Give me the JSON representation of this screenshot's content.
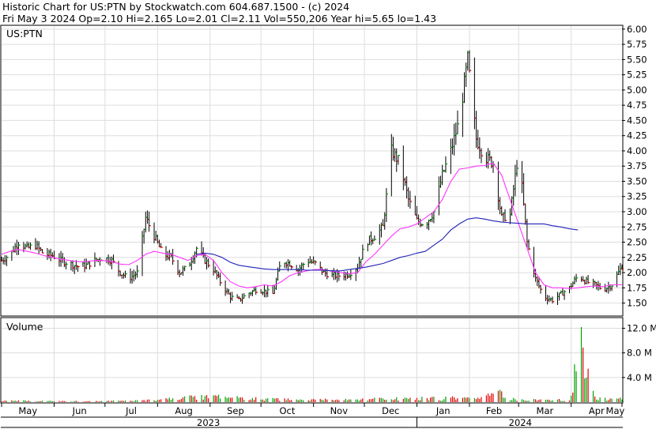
{
  "header": {
    "line1": "Historic Chart for US:PTN by Stockwatch.com 604.687.1500 - (c) 2024",
    "line2": "Fri May  3 2024  Op=2.10  Hi=2.165  Lo=2.01  Cl=2.11  Vol=550,206  Year hi=5.65  lo=1.43"
  },
  "colors": {
    "up": "#00a000",
    "down": "#e00000",
    "bar": "#000000",
    "ma_short": "#ff33ff",
    "ma_long": "#2222bb",
    "grid": "#dddddd",
    "volume_spike": "#00a000"
  },
  "chart_data": [
    {
      "type": "candlestick",
      "title": "US:PTN",
      "ylim": [
        1.3,
        6.05
      ],
      "y_ticks": [
        "6.00",
        "5.75",
        "5.50",
        "5.25",
        "5.00",
        "4.75",
        "4.50",
        "4.25",
        "4.00",
        "3.75",
        "3.50",
        "3.25",
        "3.00",
        "2.75",
        "2.50",
        "2.25",
        "2.00",
        "1.75",
        "1.50"
      ],
      "x_ticks": [
        "May",
        "Jun",
        "Jul",
        "Aug",
        "Sep",
        "Oct",
        "Nov",
        "Dec",
        "Jan",
        "Feb",
        "Mar",
        "Apr",
        "May"
      ],
      "x_years": [
        "2023",
        "2024"
      ],
      "grid": true,
      "price_x": [
        0,
        5,
        10,
        15,
        20,
        25,
        30,
        35,
        40,
        45,
        50,
        55,
        60,
        65,
        70,
        75,
        80,
        85,
        90,
        95,
        100,
        105,
        110,
        115,
        120,
        125,
        130,
        135,
        140,
        145,
        150,
        155,
        160,
        165,
        170,
        175,
        180,
        185,
        190,
        195,
        200,
        205,
        210,
        215,
        220,
        225,
        230,
        235,
        240,
        245,
        250,
        255,
        260,
        265,
        270,
        275,
        280,
        285,
        290,
        295,
        300,
        305,
        310,
        315,
        320,
        325,
        330,
        335,
        340,
        345,
        350,
        355,
        360,
        366
      ],
      "price_close": [
        2.2,
        2.3,
        2.5,
        2.4,
        2.45,
        2.3,
        2.28,
        2.2,
        2.15,
        2.1,
        2.12,
        2.2,
        2.25,
        2.2,
        2.0,
        1.9,
        2.0,
        2.9,
        2.6,
        2.3,
        2.25,
        2.0,
        2.1,
        2.4,
        2.2,
        2.05,
        1.8,
        1.6,
        1.55,
        1.65,
        1.72,
        1.7,
        1.65,
        2.2,
        2.15,
        2.05,
        2.2,
        2.15,
        2.0,
        1.95,
        1.95,
        1.98,
        2.1,
        2.5,
        2.6,
        2.75,
        4.0,
        3.8,
        3.2,
        2.85,
        2.8,
        3.0,
        3.6,
        4.0,
        4.5,
        5.5,
        4.2,
        3.9,
        3.8,
        2.9,
        2.95,
        4.0,
        2.5,
        1.9,
        1.6,
        1.55,
        1.65,
        1.75,
        1.95,
        1.85,
        1.8,
        1.72,
        1.8,
        2.11
      ],
      "ma_short": [
        2.3,
        2.35,
        2.38,
        2.35,
        2.32,
        2.28,
        2.25,
        2.22,
        2.2,
        2.18,
        2.18,
        2.2,
        2.2,
        2.18,
        2.14,
        2.13,
        2.2,
        2.3,
        2.35,
        2.32,
        2.3,
        2.25,
        2.2,
        2.28,
        2.3,
        2.2,
        2.0,
        1.85,
        1.78,
        1.75,
        1.77,
        1.8,
        1.78,
        1.85,
        1.95,
        2.0,
        2.03,
        2.05,
        2.05,
        2.02,
        2.0,
        1.98,
        2.0,
        2.18,
        2.3,
        2.45,
        2.6,
        2.72,
        2.75,
        2.8,
        2.9,
        3.0,
        3.2,
        3.5,
        3.7,
        3.72,
        3.75,
        3.76,
        3.8,
        3.6,
        3.2,
        2.8,
        2.4,
        2.0,
        1.8,
        1.75,
        1.75,
        1.74,
        1.75,
        1.77,
        1.78,
        1.77,
        1.8,
        1.8
      ],
      "ma_long": [
        null,
        null,
        null,
        null,
        null,
        null,
        null,
        null,
        null,
        null,
        null,
        null,
        null,
        null,
        null,
        null,
        null,
        null,
        null,
        null,
        null,
        null,
        null,
        2.3,
        2.32,
        2.3,
        2.25,
        2.17,
        2.12,
        2.1,
        2.08,
        2.06,
        2.05,
        2.05,
        2.05,
        2.05,
        2.04,
        2.04,
        2.04,
        2.03,
        2.03,
        2.05,
        2.07,
        2.09,
        2.12,
        2.15,
        2.2,
        2.25,
        2.28,
        2.32,
        2.35,
        2.45,
        2.55,
        2.7,
        2.8,
        2.88,
        2.9,
        2.88,
        2.85,
        2.83,
        2.82,
        2.81,
        2.8,
        2.8,
        2.8,
        2.77,
        2.75,
        2.72,
        2.7
      ]
    },
    {
      "type": "bar",
      "title": "Volume",
      "ylim": [
        0,
        13.6
      ],
      "y_ticks": [
        "12.0 M",
        "8.0 M",
        "4.0 M"
      ],
      "volume_x": [
        0,
        30,
        60,
        90,
        120,
        150,
        180,
        200,
        210,
        220,
        230,
        235,
        240,
        245,
        250,
        255,
        260,
        265,
        270,
        275,
        280,
        285,
        290,
        292,
        294,
        296,
        300,
        310,
        320,
        330,
        335,
        342,
        350,
        360,
        366
      ],
      "volume_m": [
        0.3,
        0.2,
        0.2,
        0.4,
        1.2,
        0.7,
        0.4,
        0.6,
        0.5,
        0.7,
        0.5,
        0.8,
        0.6,
        1.1,
        0.5,
        0.9,
        0.7,
        1.0,
        0.5,
        0.8,
        0.6,
        1.0,
        1.5,
        3.9,
        2.0,
        1.0,
        0.7,
        0.5,
        0.4,
        0.5,
        0.6,
        12.2,
        0.8,
        0.5,
        0.8
      ]
    }
  ]
}
